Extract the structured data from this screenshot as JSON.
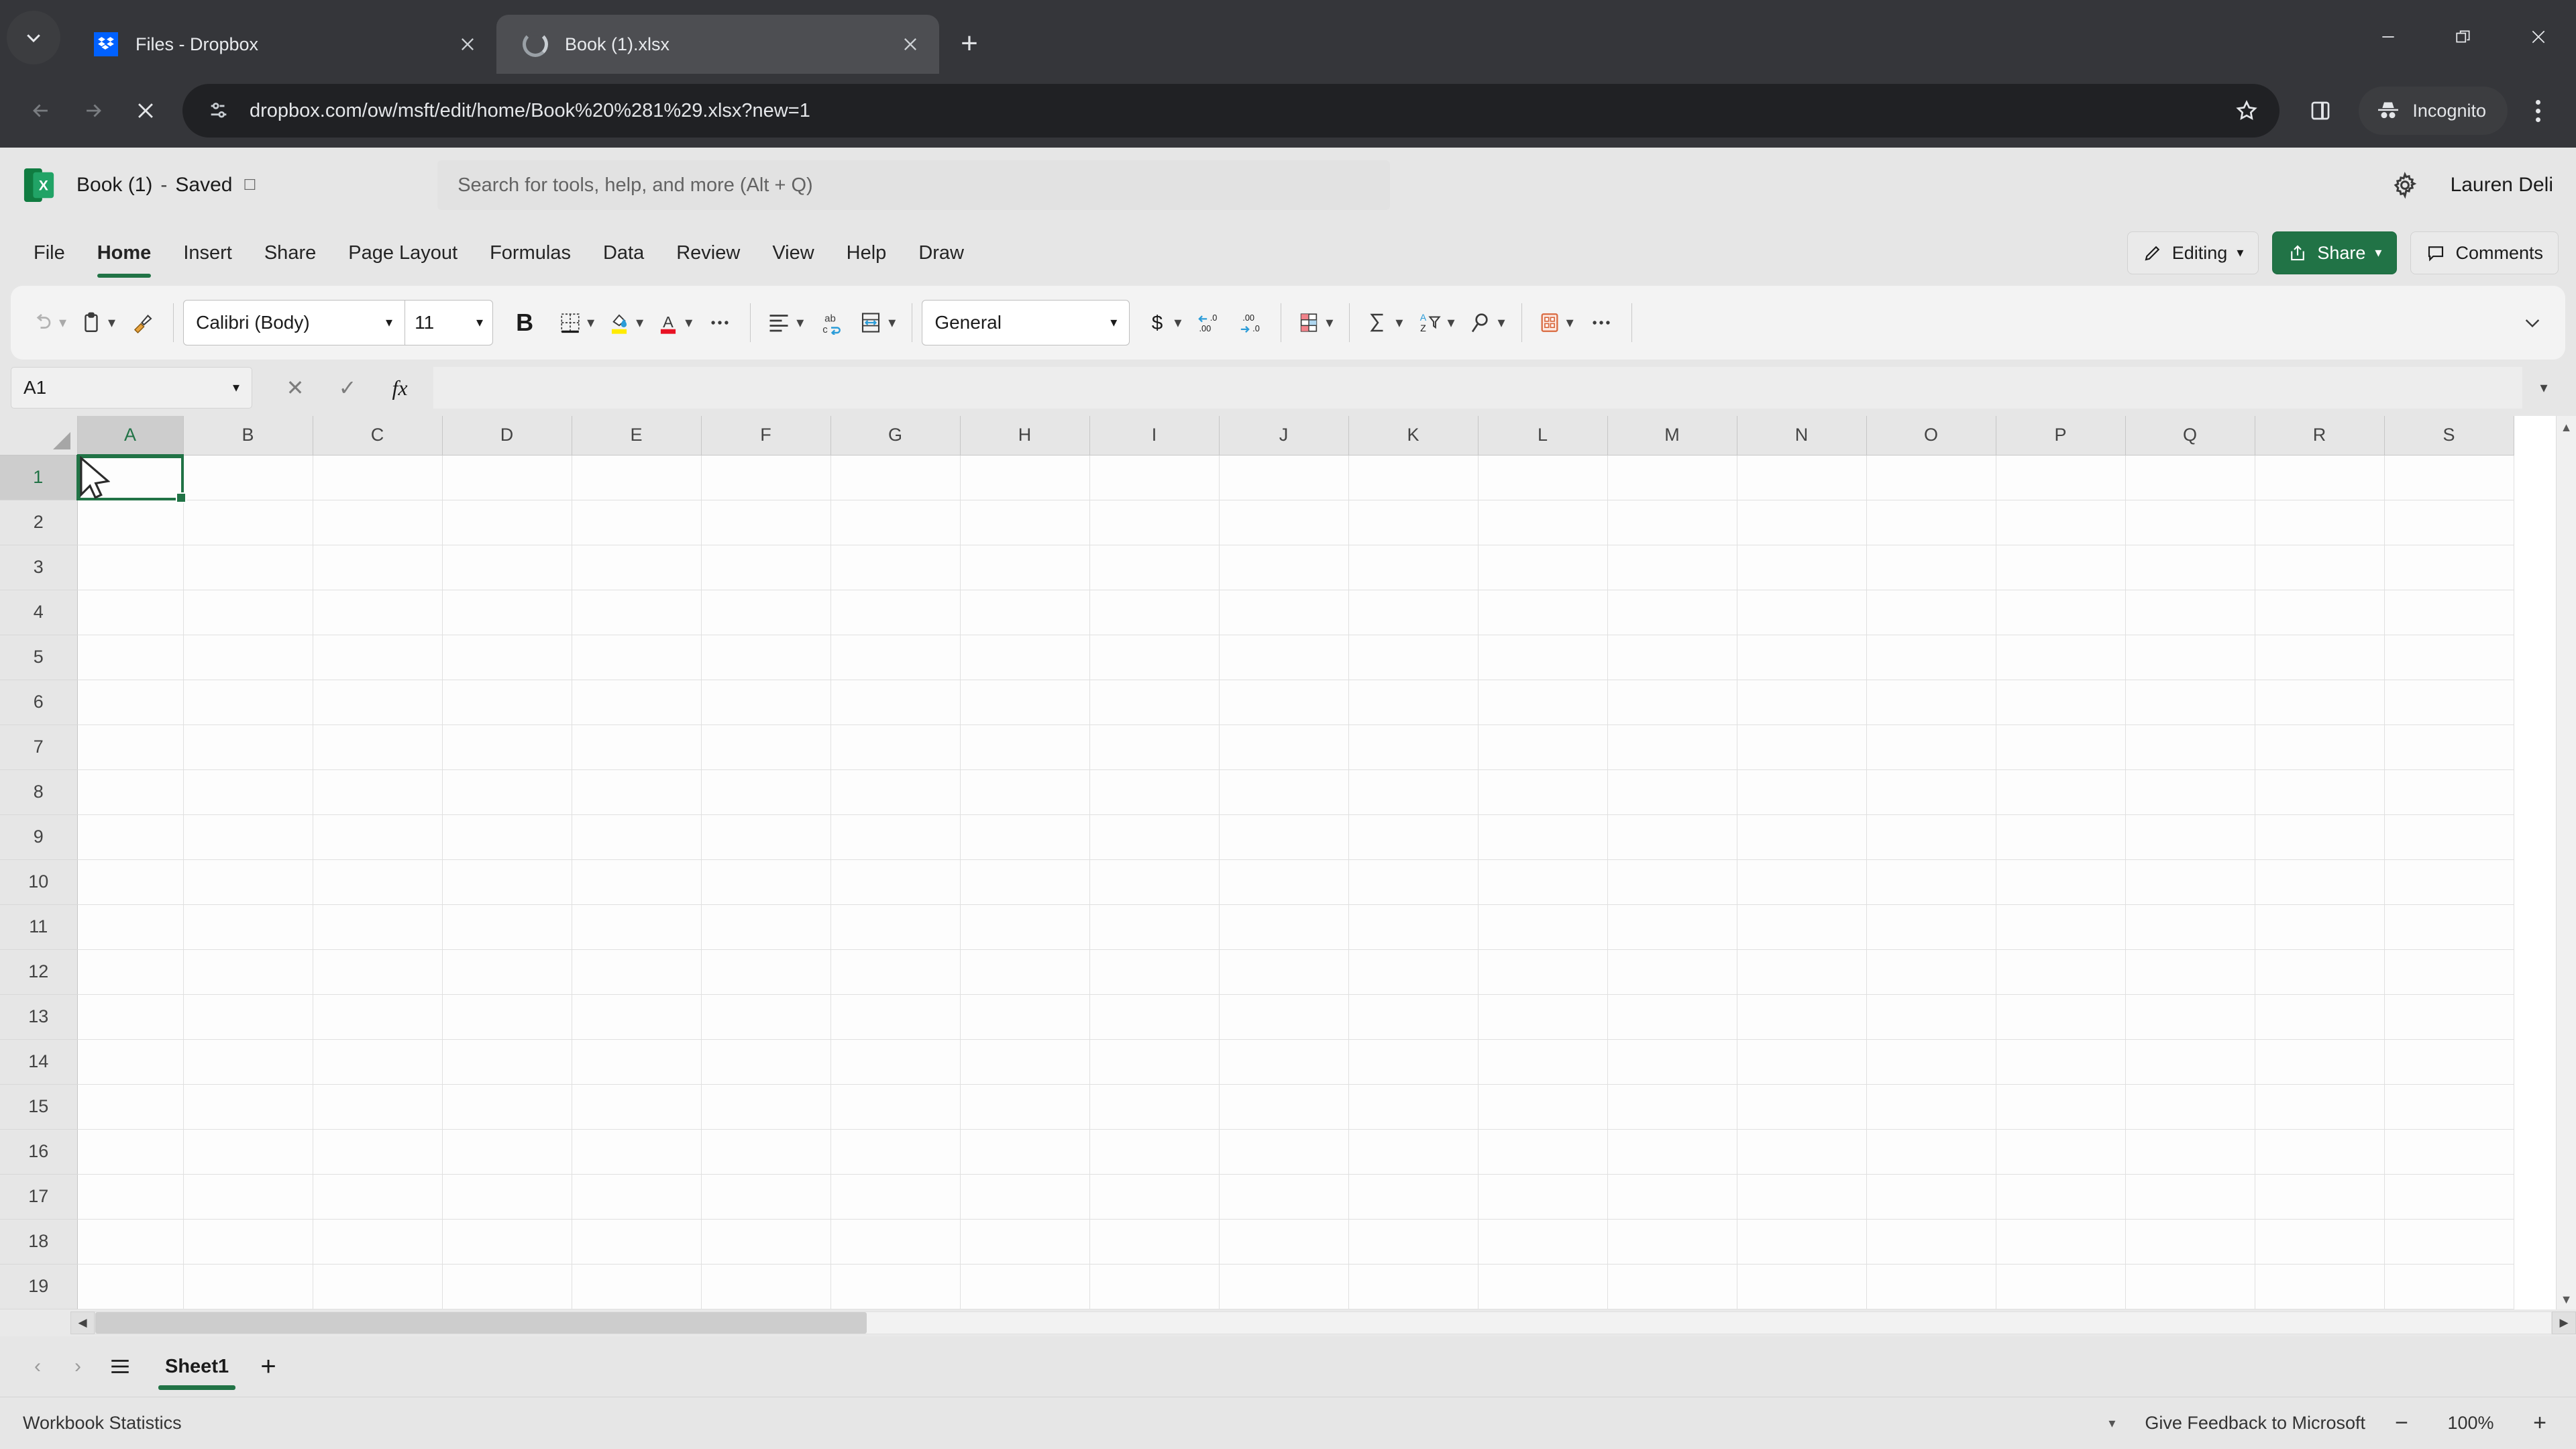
{
  "browser": {
    "tab_search_icon": "chevron-down-icon",
    "tabs": [
      {
        "title": "Files - Dropbox",
        "favicon": "dropbox-icon",
        "active": false
      },
      {
        "title": "Book (1).xlsx",
        "favicon": "loading-spinner-icon",
        "active": true
      }
    ],
    "new_tab_label": "+",
    "window_controls": {
      "minimize": "minimize-icon",
      "maximize": "restore-icon",
      "close": "close-icon"
    },
    "nav": {
      "back": "back-arrow-icon",
      "forward": "forward-arrow-icon",
      "stop": "stop-loading-icon"
    },
    "omnibox": {
      "site_info_icon": "site-settings-icon",
      "url": "dropbox.com/ow/msft/edit/home/Book%20%281%29.xlsx?new=1",
      "bookmark_icon": "star-icon",
      "side_panel_icon": "side-panel-icon"
    },
    "incognito": {
      "label": "Incognito",
      "icon": "incognito-hat-icon"
    },
    "menu_icon": "three-dots-menu-icon"
  },
  "excel": {
    "app_icon": "excel-logo-icon",
    "doc_title": "Book (1)",
    "title_separator": "-",
    "save_status": "Saved",
    "cloud_icon": "cloud-upload-icon",
    "search": {
      "placeholder": "Search for tools, help, and more (Alt + Q)"
    },
    "settings_icon": "gear-icon",
    "user_name": "Lauren Deli",
    "ribbon_tabs": [
      {
        "label": "File",
        "active": false
      },
      {
        "label": "Home",
        "active": true
      },
      {
        "label": "Insert",
        "active": false
      },
      {
        "label": "Share",
        "active": false
      },
      {
        "label": "Page Layout",
        "active": false
      },
      {
        "label": "Formulas",
        "active": false
      },
      {
        "label": "Data",
        "active": false
      },
      {
        "label": "Review",
        "active": false
      },
      {
        "label": "View",
        "active": false
      },
      {
        "label": "Help",
        "active": false
      },
      {
        "label": "Draw",
        "active": false
      }
    ],
    "ribbon_actions": {
      "editing_label": "Editing",
      "share_label": "Share",
      "comments_label": "Comments"
    },
    "toolbar": {
      "undo_icon": "undo-icon",
      "paste_icon": "paste-icon",
      "format_painter_icon": "format-painter-icon",
      "font_name": "Calibri (Body)",
      "font_size": "11",
      "bold_label": "B",
      "borders_icon": "borders-icon",
      "fill_color_icon": "fill-color-icon",
      "font_color_icon": "font-color-icon",
      "more_font_icon": "more-options-icon",
      "align_icon": "align-left-icon",
      "wrap_text_icon": "wrap-text-icon",
      "merge_cells_icon": "merge-cells-icon",
      "number_format": "General",
      "currency_icon": "currency-icon",
      "decrease_decimal_icon": "decrease-decimal-icon",
      "increase_decimal_icon": "increase-decimal-icon",
      "conditional_formatting_icon": "conditional-formatting-icon",
      "autosum_icon": "autosum-icon",
      "sort_filter_icon": "sort-and-filter-icon",
      "find_icon": "find-icon",
      "ideas_icon": "analyze-data-icon",
      "more_commands_icon": "more-options-icon",
      "collapse_ribbon_icon": "chevron-down-icon"
    },
    "formula_bar": {
      "name_box": "A1",
      "cancel_icon": "cancel-icon",
      "enter_icon": "confirm-icon",
      "function_icon": "fx",
      "value": "",
      "expand_icon": "chevron-down-icon"
    },
    "grid": {
      "columns": [
        "A",
        "B",
        "C",
        "D",
        "E",
        "F",
        "G",
        "H",
        "I",
        "J",
        "K",
        "L",
        "M",
        "N",
        "O",
        "P",
        "Q",
        "R",
        "S"
      ],
      "rows": [
        1,
        2,
        3,
        4,
        5,
        6,
        7,
        8,
        9,
        10,
        11,
        12,
        13,
        14,
        15,
        16,
        17,
        18,
        19
      ],
      "selected_cell": "A1",
      "selected_column": "A",
      "selected_row": 1,
      "cell_values": {}
    },
    "sheet_bar": {
      "prev_icon": "chevron-left-icon",
      "next_icon": "chevron-right-icon",
      "all_sheets_icon": "all-sheets-icon",
      "sheets": [
        {
          "name": "Sheet1",
          "active": true
        }
      ],
      "add_sheet_label": "+"
    },
    "status_bar": {
      "workbook_statistics": "Workbook Statistics",
      "feedback": "Give Feedback to Microsoft",
      "zoom_out": "−",
      "zoom_level": "100%",
      "zoom_in": "+"
    },
    "colors": {
      "accent_green": "#217346",
      "chrome_dark": "#35363a",
      "omnibox_dark": "#202124",
      "ribbon_bg": "#f3f3f3",
      "app_bg": "#e6e6e6"
    }
  }
}
